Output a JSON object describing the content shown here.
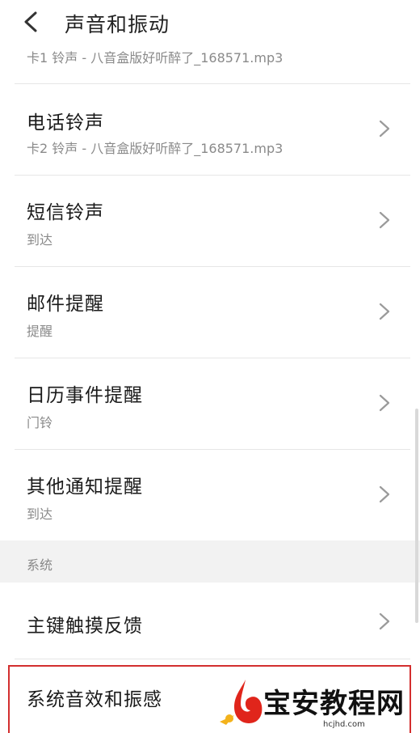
{
  "header": {
    "title": "声音和振动",
    "back_icon": "chevron-left-icon"
  },
  "partial_item": {
    "subtitle": "卡1 铃声 - 八音盒版好听醉了_168571.mp3"
  },
  "items": [
    {
      "title": "电话铃声",
      "subtitle": "卡2 铃声 - 八音盒版好听醉了_168571.mp3",
      "icon": "chevron-right-icon"
    },
    {
      "title": "短信铃声",
      "subtitle": "到达",
      "icon": "chevron-right-icon"
    },
    {
      "title": "邮件提醒",
      "subtitle": "提醒",
      "icon": "chevron-right-icon"
    },
    {
      "title": "日历事件提醒",
      "subtitle": "门铃",
      "icon": "chevron-right-icon"
    },
    {
      "title": "其他通知提醒",
      "subtitle": "到达",
      "icon": "chevron-right-icon"
    }
  ],
  "section": {
    "label": "系统"
  },
  "system_items": [
    {
      "title": "主键触摸反馈",
      "icon": "chevron-right-icon"
    },
    {
      "title": "系统音效和振感"
    }
  ],
  "watermark": {
    "text": "宝安教程网",
    "url": "hcjhd.com"
  },
  "colors": {
    "highlight": "#d32f2f",
    "logo_red": "#e0251b",
    "logo_yellow": "#f3b21b"
  }
}
